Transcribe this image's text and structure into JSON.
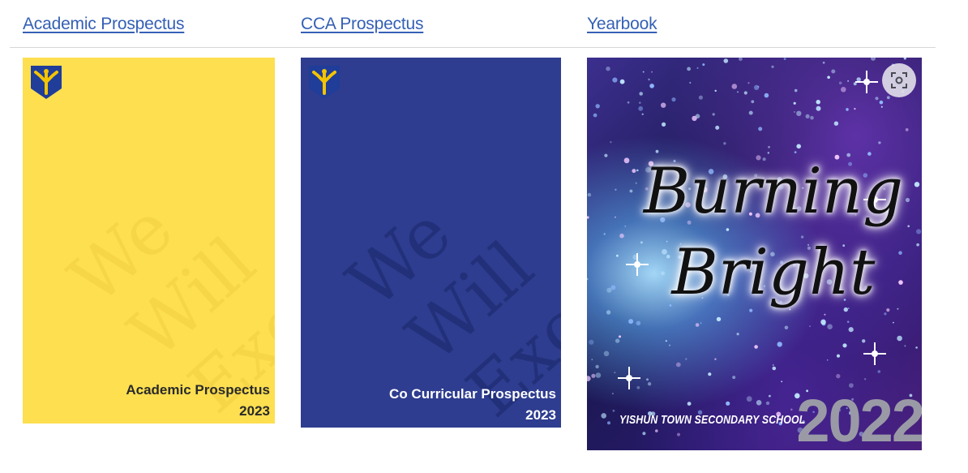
{
  "tabs": [
    {
      "label": "Academic Prospectus"
    },
    {
      "label": "CCA Prospectus"
    },
    {
      "label": "Yearbook"
    }
  ],
  "watermark_lines": [
    "We",
    "Will",
    "Excel"
  ],
  "academic_cover": {
    "title_line1": "Academic Prospectus",
    "title_line2": "2023",
    "bg_color": "#fddf50"
  },
  "cca_cover": {
    "title_line1": "Co Curricular Prospectus",
    "title_line2": "2023",
    "bg_color": "#2e3d8f"
  },
  "yearbook_cover": {
    "title_line1": "Burning",
    "title_line2": "Bright",
    "school": "YISHUN TOWN SECONDARY SCHOOL",
    "year": "2022"
  },
  "icons": {
    "crest": "school-crest-icon",
    "lens": "visual-search-icon"
  },
  "colors": {
    "link": "#3560b5",
    "crest_blue": "#1f3d99",
    "crest_gold": "#f4c400"
  }
}
